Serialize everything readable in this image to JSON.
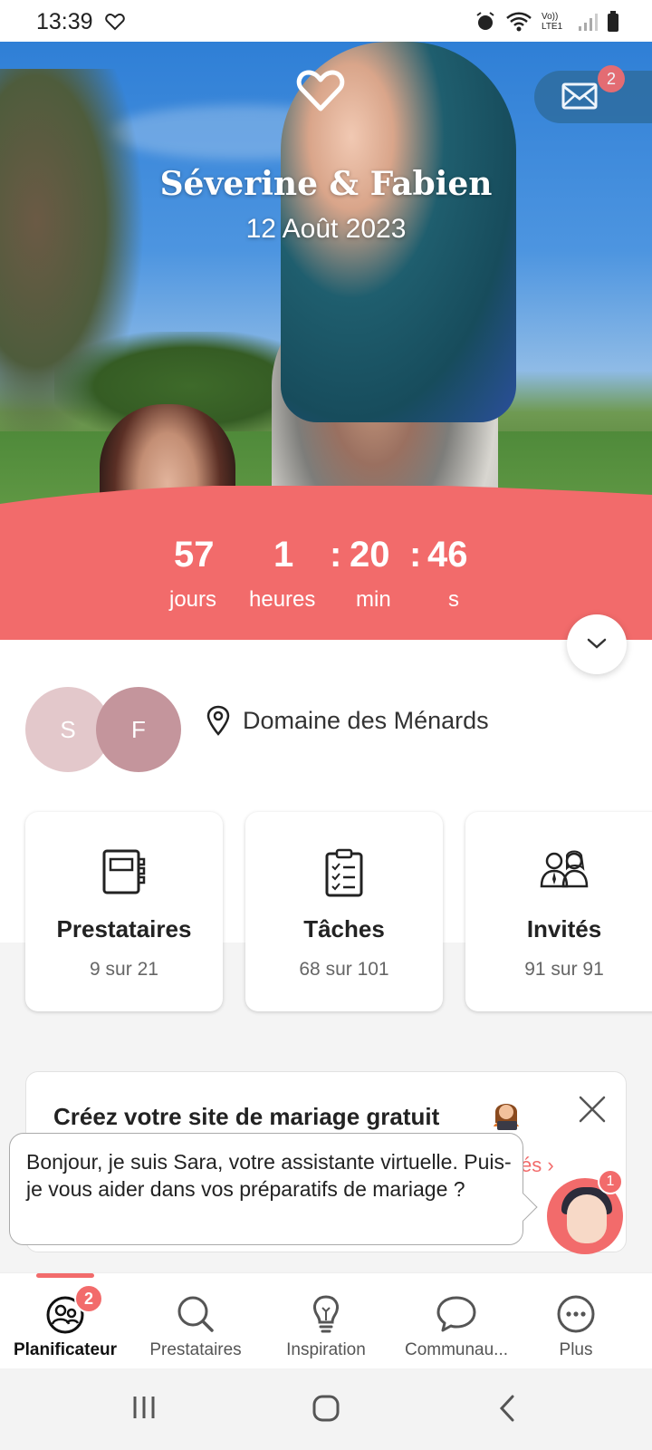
{
  "status_bar": {
    "time": "13:39",
    "network": "Vo)) LTE1"
  },
  "hero": {
    "names": "Séverine & Fabien",
    "date": "12 Août 2023",
    "mail_badge": "2"
  },
  "countdown": {
    "days": "57",
    "days_label": "jours",
    "hours": "1",
    "hours_label": "heures",
    "minutes": "20",
    "minutes_label": "min",
    "seconds": "46",
    "seconds_label": "s",
    "separator": ":"
  },
  "couple": {
    "partner1_initial": "S",
    "partner2_initial": "F",
    "venue": "Domaine des Ménards"
  },
  "cards": [
    {
      "title": "Prestataires",
      "subtitle": "9 sur 21",
      "icon": "notebook-icon"
    },
    {
      "title": "Tâches",
      "subtitle": "68 sur 101",
      "icon": "checklist-icon"
    },
    {
      "title": "Invités",
      "subtitle": "91 sur 91",
      "icon": "guests-icon"
    }
  ],
  "promo": {
    "title": "Créez votre site de mariage gratuit",
    "link_label": "és ›"
  },
  "assistant": {
    "message": "Bonjour, je suis Sara, votre assistante virtuelle. Puis-je vous aider dans vos préparatifs de mariage ?",
    "badge": "1"
  },
  "bottom_nav": {
    "items": [
      {
        "label": "Planificateur",
        "icon": "planner-icon",
        "badge": "2",
        "active": true
      },
      {
        "label": "Prestataires",
        "icon": "search-icon"
      },
      {
        "label": "Inspiration",
        "icon": "lightbulb-icon"
      },
      {
        "label": "Communau...",
        "icon": "chat-bubble-icon"
      },
      {
        "label": "Plus",
        "icon": "more-icon"
      }
    ]
  },
  "colors": {
    "accent": "#f26b6b",
    "avatar_s": "#e3c8cb",
    "avatar_f": "#c4959c",
    "mail_pill": "#2f6fa5"
  }
}
